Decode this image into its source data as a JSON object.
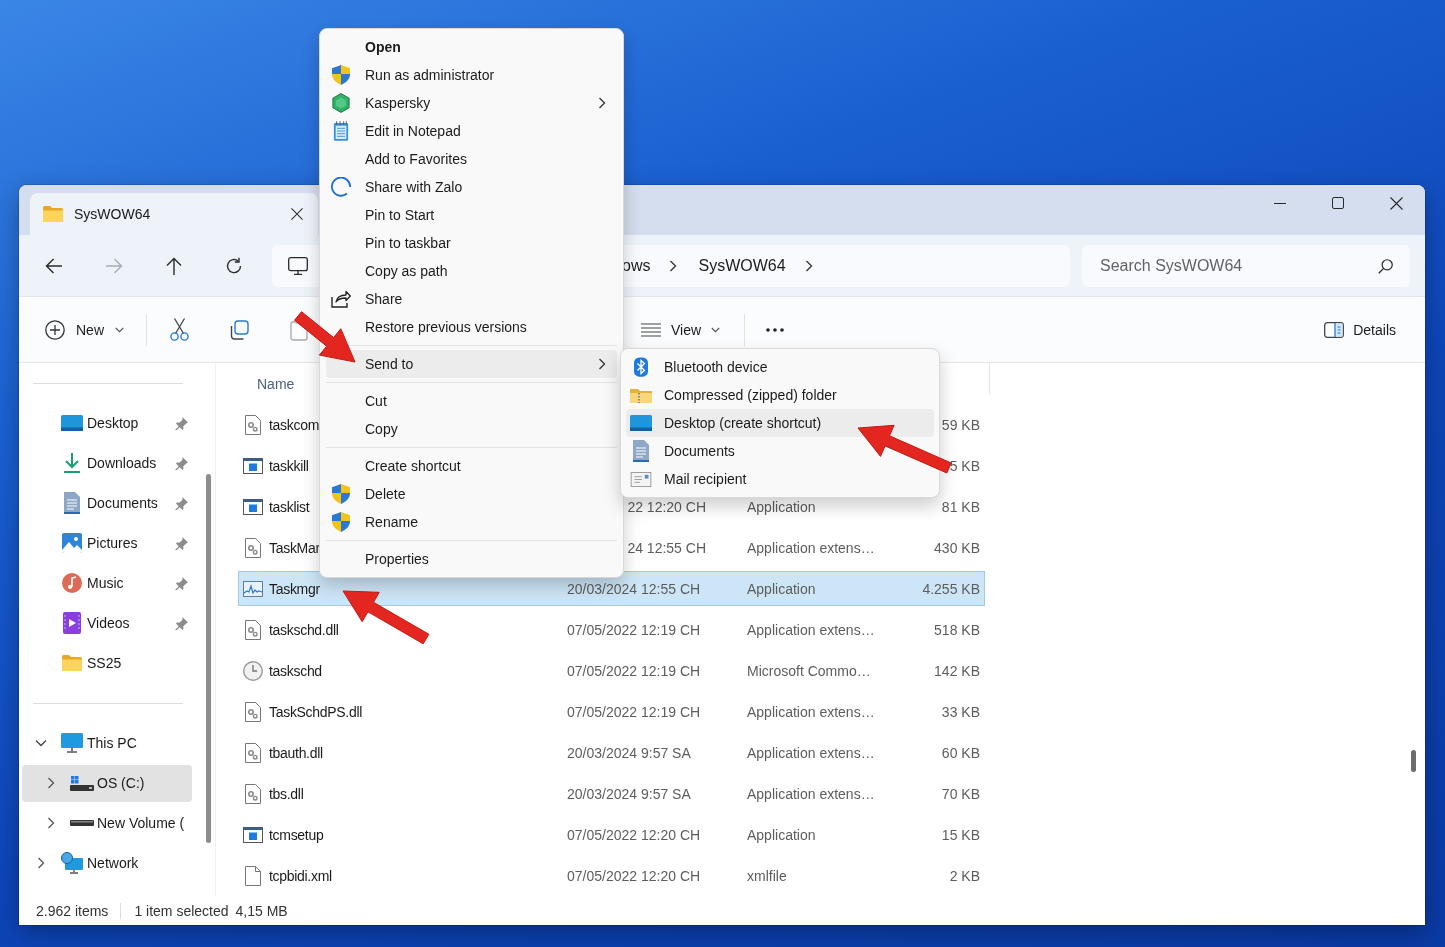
{
  "tab": {
    "title": "SysWOW64"
  },
  "navigation": {
    "buttons": [
      {
        "disabled": false
      },
      {
        "disabled": true
      },
      {
        "disabled": false
      },
      {
        "disabled": false
      }
    ]
  },
  "address_bar": {
    "crumbs": [
      "ows",
      "SysWOW64"
    ]
  },
  "search": {
    "placeholder": "Search SysWOW64"
  },
  "toolbar": {
    "new_label": "New",
    "view_label": "View",
    "details_label": "Details"
  },
  "sidebar": {
    "quick_access": [
      {
        "label": "Desktop",
        "pinned": true
      },
      {
        "label": "Downloads",
        "pinned": true
      },
      {
        "label": "Documents",
        "pinned": true
      },
      {
        "label": "Pictures",
        "pinned": true
      },
      {
        "label": "Music",
        "pinned": true
      },
      {
        "label": "Videos",
        "pinned": true
      },
      {
        "label": "SS25",
        "pinned": false
      }
    ],
    "tree": [
      {
        "label": "This PC",
        "expanded": true,
        "selected": false,
        "children": [
          {
            "label": "OS (C:)",
            "expanded": false,
            "selected": true
          },
          {
            "label": "New Volume (",
            "expanded": false,
            "selected": false
          }
        ]
      },
      {
        "label": "Network",
        "expanded": false,
        "selected": false
      }
    ]
  },
  "file_list": {
    "columns": [
      "Name"
    ],
    "rows": [
      {
        "name": "taskcom",
        "size": "59 KB",
        "selected": false
      },
      {
        "name": "taskkill",
        "size": "5 KB",
        "selected": false
      },
      {
        "name": "tasklist",
        "date_partial": "22 12:20 CH",
        "type": "Application",
        "size": "81 KB",
        "selected": false
      },
      {
        "name": "TaskMar",
        "date_partial": "24 12:55 CH",
        "type": "Application extens…",
        "size": "430 KB",
        "selected": false
      },
      {
        "name": "Taskmgr",
        "date": "20/03/2024 12:55 CH",
        "type": "Application",
        "size": "4.255 KB",
        "selected": true
      },
      {
        "name": "taskschd.dll",
        "date": "07/05/2022 12:19 CH",
        "type": "Application extens…",
        "size": "518 KB",
        "selected": false
      },
      {
        "name": "taskschd",
        "date": "07/05/2022 12:19 CH",
        "type": "Microsoft Commo…",
        "size": "142 KB",
        "selected": false
      },
      {
        "name": "TaskSchdPS.dll",
        "date": "07/05/2022 12:19 CH",
        "type": "Application extens…",
        "size": "33 KB",
        "selected": false
      },
      {
        "name": "tbauth.dll",
        "date": "20/03/2024 9:57 SA",
        "type": "Application extens…",
        "size": "60 KB",
        "selected": false
      },
      {
        "name": "tbs.dll",
        "date": "20/03/2024 9:57 SA",
        "type": "Application extens…",
        "size": "70 KB",
        "selected": false
      },
      {
        "name": "tcmsetup",
        "date": "07/05/2022 12:20 CH",
        "type": "Application",
        "size": "15 KB",
        "selected": false
      },
      {
        "name": "tcpbidi.xml",
        "date": "07/05/2022 12:20 CH",
        "type": "xmlfile",
        "size": "2 KB",
        "selected": false
      }
    ]
  },
  "status_bar": {
    "item_count": "2.962 items",
    "selection": "1 item selected",
    "selection_size": "4,15 MB"
  },
  "context_menu": {
    "groups": [
      [
        {
          "label": "Open",
          "default": true,
          "submenu": false,
          "highlighted": false
        },
        {
          "label": "Run as administrator",
          "default": false,
          "submenu": false,
          "highlighted": false
        },
        {
          "label": "Kaspersky",
          "default": false,
          "submenu": true,
          "highlighted": false
        },
        {
          "label": "Edit in Notepad",
          "default": false,
          "submenu": false,
          "highlighted": false
        },
        {
          "label": "Add to Favorites",
          "default": false,
          "submenu": false,
          "highlighted": false
        },
        {
          "label": "Share with Zalo",
          "default": false,
          "submenu": false,
          "highlighted": false
        },
        {
          "label": "Pin to Start",
          "default": false,
          "submenu": false,
          "highlighted": false
        },
        {
          "label": "Pin to taskbar",
          "default": false,
          "submenu": false,
          "highlighted": false
        },
        {
          "label": "Copy as path",
          "default": false,
          "submenu": false,
          "highlighted": false
        },
        {
          "label": "Share",
          "default": false,
          "submenu": false,
          "highlighted": false
        },
        {
          "label": "Restore previous versions",
          "default": false,
          "submenu": false,
          "highlighted": false
        }
      ],
      [
        {
          "label": "Send to",
          "default": false,
          "submenu": true,
          "highlighted": true
        }
      ],
      [
        {
          "label": "Cut",
          "default": false,
          "submenu": false,
          "highlighted": false
        },
        {
          "label": "Copy",
          "default": false,
          "submenu": false,
          "highlighted": false
        }
      ],
      [
        {
          "label": "Create shortcut",
          "default": false,
          "submenu": false,
          "highlighted": false
        },
        {
          "label": "Delete",
          "default": false,
          "submenu": false,
          "highlighted": false
        },
        {
          "label": "Rename",
          "default": false,
          "submenu": false,
          "highlighted": false
        }
      ],
      [
        {
          "label": "Properties",
          "default": false,
          "submenu": false,
          "highlighted": false
        }
      ]
    ]
  },
  "send_to_menu": {
    "items": [
      {
        "label": "Bluetooth device",
        "highlighted": false
      },
      {
        "label": "Compressed (zipped) folder",
        "highlighted": false
      },
      {
        "label": "Desktop (create shortcut)",
        "highlighted": true
      },
      {
        "label": "Documents",
        "highlighted": false
      },
      {
        "label": "Mail recipient",
        "highlighted": false
      }
    ]
  }
}
